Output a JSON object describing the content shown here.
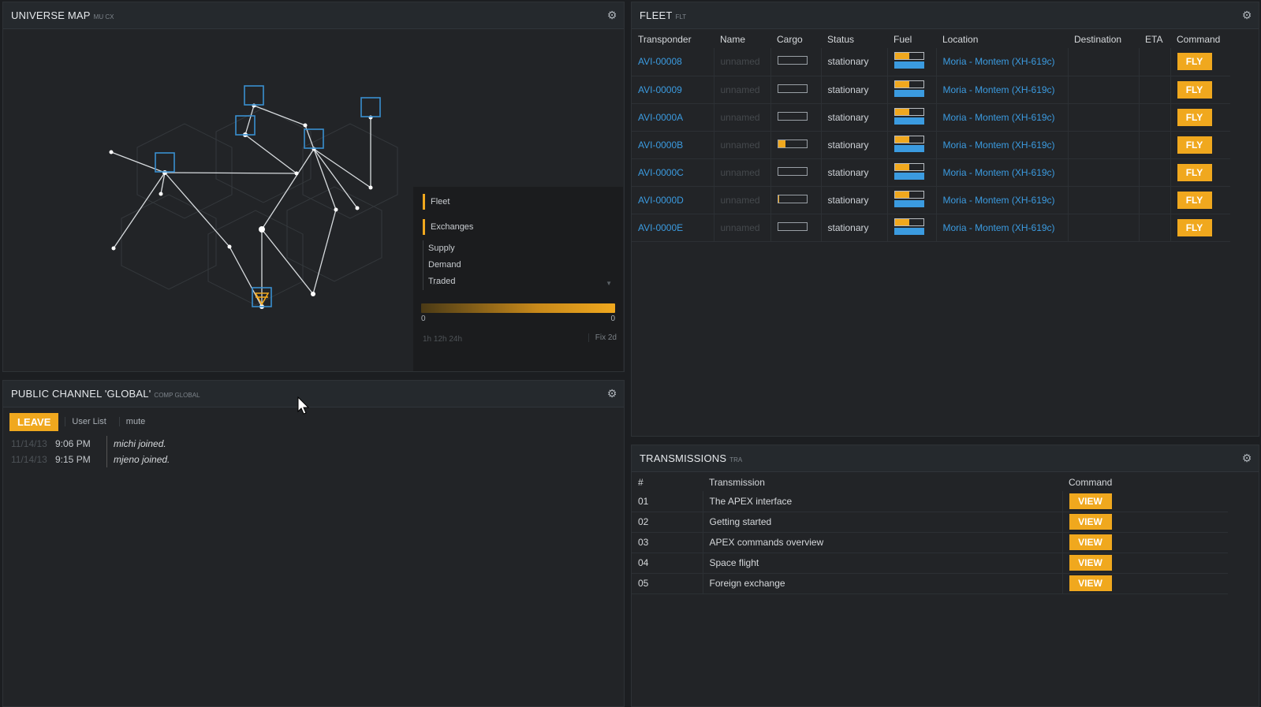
{
  "map": {
    "title": "UNIVERSE MAP",
    "code": "MU CX",
    "legend": {
      "fleet": "Fleet",
      "exchanges": "Exchanges",
      "sub": [
        "Supply",
        "Demand",
        "Traded"
      ]
    },
    "dropdown_value": "--",
    "slider_min": "0",
    "slider_max": "0",
    "time_options": "1h  12h  24h",
    "fix_label": "Fix 2d"
  },
  "chat": {
    "title": "PUBLIC CHANNEL 'GLOBAL'",
    "code": "COMP GLOBAL",
    "leave_label": "LEAVE",
    "user_list_label": "User List",
    "mute_label": "mute",
    "messages": [
      {
        "date": "11/14/13",
        "time": "9:06 PM",
        "text": "michi joined."
      },
      {
        "date": "11/14/13",
        "time": "9:15 PM",
        "text": "mjeno joined."
      }
    ]
  },
  "fleet": {
    "title": "FLEET",
    "code": "FLT",
    "columns": [
      "Transponder",
      "Name",
      "Cargo",
      "Status",
      "Fuel",
      "Location",
      "Destination",
      "ETA",
      "Command"
    ],
    "rows": [
      {
        "transponder": "AVI-00008",
        "name": "unnamed",
        "cargo": 0,
        "status": "stationary",
        "fuel": 0.5,
        "location": "Moria - Montem (XH-619c)",
        "destination": "",
        "eta": "",
        "command": "FLY"
      },
      {
        "transponder": "AVI-00009",
        "name": "unnamed",
        "cargo": 0,
        "status": "stationary",
        "fuel": 0.5,
        "location": "Moria - Montem (XH-619c)",
        "destination": "",
        "eta": "",
        "command": "FLY"
      },
      {
        "transponder": "AVI-0000A",
        "name": "unnamed",
        "cargo": 0,
        "status": "stationary",
        "fuel": 0.5,
        "location": "Moria - Montem (XH-619c)",
        "destination": "",
        "eta": "",
        "command": "FLY"
      },
      {
        "transponder": "AVI-0000B",
        "name": "unnamed",
        "cargo": 0.25,
        "status": "stationary",
        "fuel": 0.5,
        "location": "Moria - Montem (XH-619c)",
        "destination": "",
        "eta": "",
        "command": "FLY"
      },
      {
        "transponder": "AVI-0000C",
        "name": "unnamed",
        "cargo": 0,
        "status": "stationary",
        "fuel": 0.5,
        "location": "Moria - Montem (XH-619c)",
        "destination": "",
        "eta": "",
        "command": "FLY"
      },
      {
        "transponder": "AVI-0000D",
        "name": "unnamed",
        "cargo": 0.05,
        "status": "stationary",
        "fuel": 0.5,
        "location": "Moria - Montem (XH-619c)",
        "destination": "",
        "eta": "",
        "command": "FLY"
      },
      {
        "transponder": "AVI-0000E",
        "name": "unnamed",
        "cargo": 0,
        "status": "stationary",
        "fuel": 0.5,
        "location": "Moria - Montem (XH-619c)",
        "destination": "",
        "eta": "",
        "command": "FLY"
      }
    ]
  },
  "transmissions": {
    "title": "TRANSMISSIONS",
    "code": "TRA",
    "columns": [
      "#",
      "Transmission",
      "Command"
    ],
    "rows": [
      {
        "num": "01",
        "title": "The APEX interface",
        "command": "VIEW"
      },
      {
        "num": "02",
        "title": "Getting started",
        "command": "VIEW"
      },
      {
        "num": "03",
        "title": "APEX commands overview",
        "command": "VIEW"
      },
      {
        "num": "04",
        "title": "Space flight",
        "command": "VIEW"
      },
      {
        "num": "05",
        "title": "Foreign exchange",
        "command": "VIEW"
      }
    ]
  },
  "colors": {
    "accent": "#f0a81e",
    "link": "#3b9be0",
    "map_node": "#3a8fd0",
    "map_line": "#d8dcdf"
  },
  "icons": {
    "settings": "gear-icon",
    "cursor": "mouse-pointer-icon"
  }
}
